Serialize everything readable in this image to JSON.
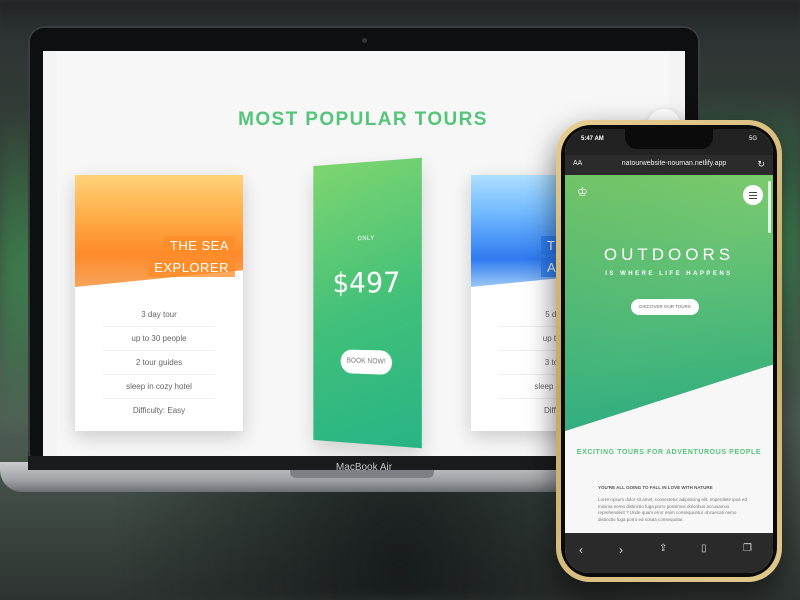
{
  "laptop": {
    "brand": "MacBook Air",
    "page": {
      "section_title": "MOST POPULAR TOURS",
      "cards": [
        {
          "heading_line1": "THE SEA",
          "heading_line2": "EXPLORER",
          "details": [
            "3 day tour",
            "up to 30 people",
            "2 tour guides",
            "sleep in cozy hotel",
            "Difficulty: Easy"
          ]
        },
        {
          "heading_line1": "T",
          "heading_line2": "AD",
          "details": [
            "5 day",
            "up to 1",
            "3 tour",
            "sleep in pro",
            "Difficu"
          ]
        }
      ],
      "price_card": {
        "label": "ONLY",
        "price": "$497",
        "button": "BOOK NOW!"
      }
    }
  },
  "phone": {
    "status": {
      "time": "5:47 AM",
      "signal": "5G"
    },
    "url_bar": {
      "aa": "AA",
      "url": "natourwebsite-nouman.netlify.app"
    },
    "hero": {
      "title": "OUTDOORS",
      "subtitle": "IS WHERE LIFE HAPPENS",
      "button": "DISCOVER OUR TOURS"
    },
    "section_title": "EXCITING TOURS FOR ADVENTUROUS PEOPLE",
    "heading": "YOU'RE ALL GOING TO FALL IN LOVE WITH NATURE",
    "paragraph": "Lorem ipsum dolor sit amet, consectetur adipisicing elit. Imperdiete ipsa ed minima nemo distinctio fuga porro possimus doloribus accusamus reprehenderit ? Unde quam error enim consequuntur obcaecati nemo distinctio fuga porro ed soluta consequatur."
  }
}
